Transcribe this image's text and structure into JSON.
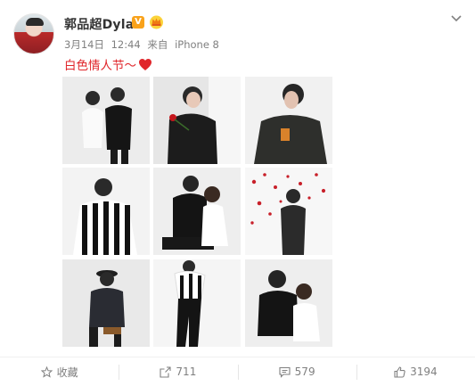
{
  "post": {
    "username": "郭品超Dylan",
    "verified_badge": "V",
    "date": "3月14日",
    "time": "12:44",
    "source_prefix": "来自",
    "source": "iPhone 8",
    "text": "白色情人节～"
  },
  "footer": {
    "favorite_label": "收藏",
    "repost_count": "711",
    "comment_count": "579",
    "like_count": "3194"
  },
  "icons": {
    "verified": "verified-v-icon",
    "member": "crown-icon",
    "menu": "chevron-down-icon",
    "emoji": "heart-icon",
    "favorite": "star-icon",
    "repost": "share-icon",
    "comment": "comment-icon",
    "like": "thumbs-up-icon"
  },
  "colors": {
    "text_primary": "#333333",
    "text_secondary": "#808080",
    "verified_orange": "#f9a21b",
    "heart_red": "#e0262b"
  }
}
